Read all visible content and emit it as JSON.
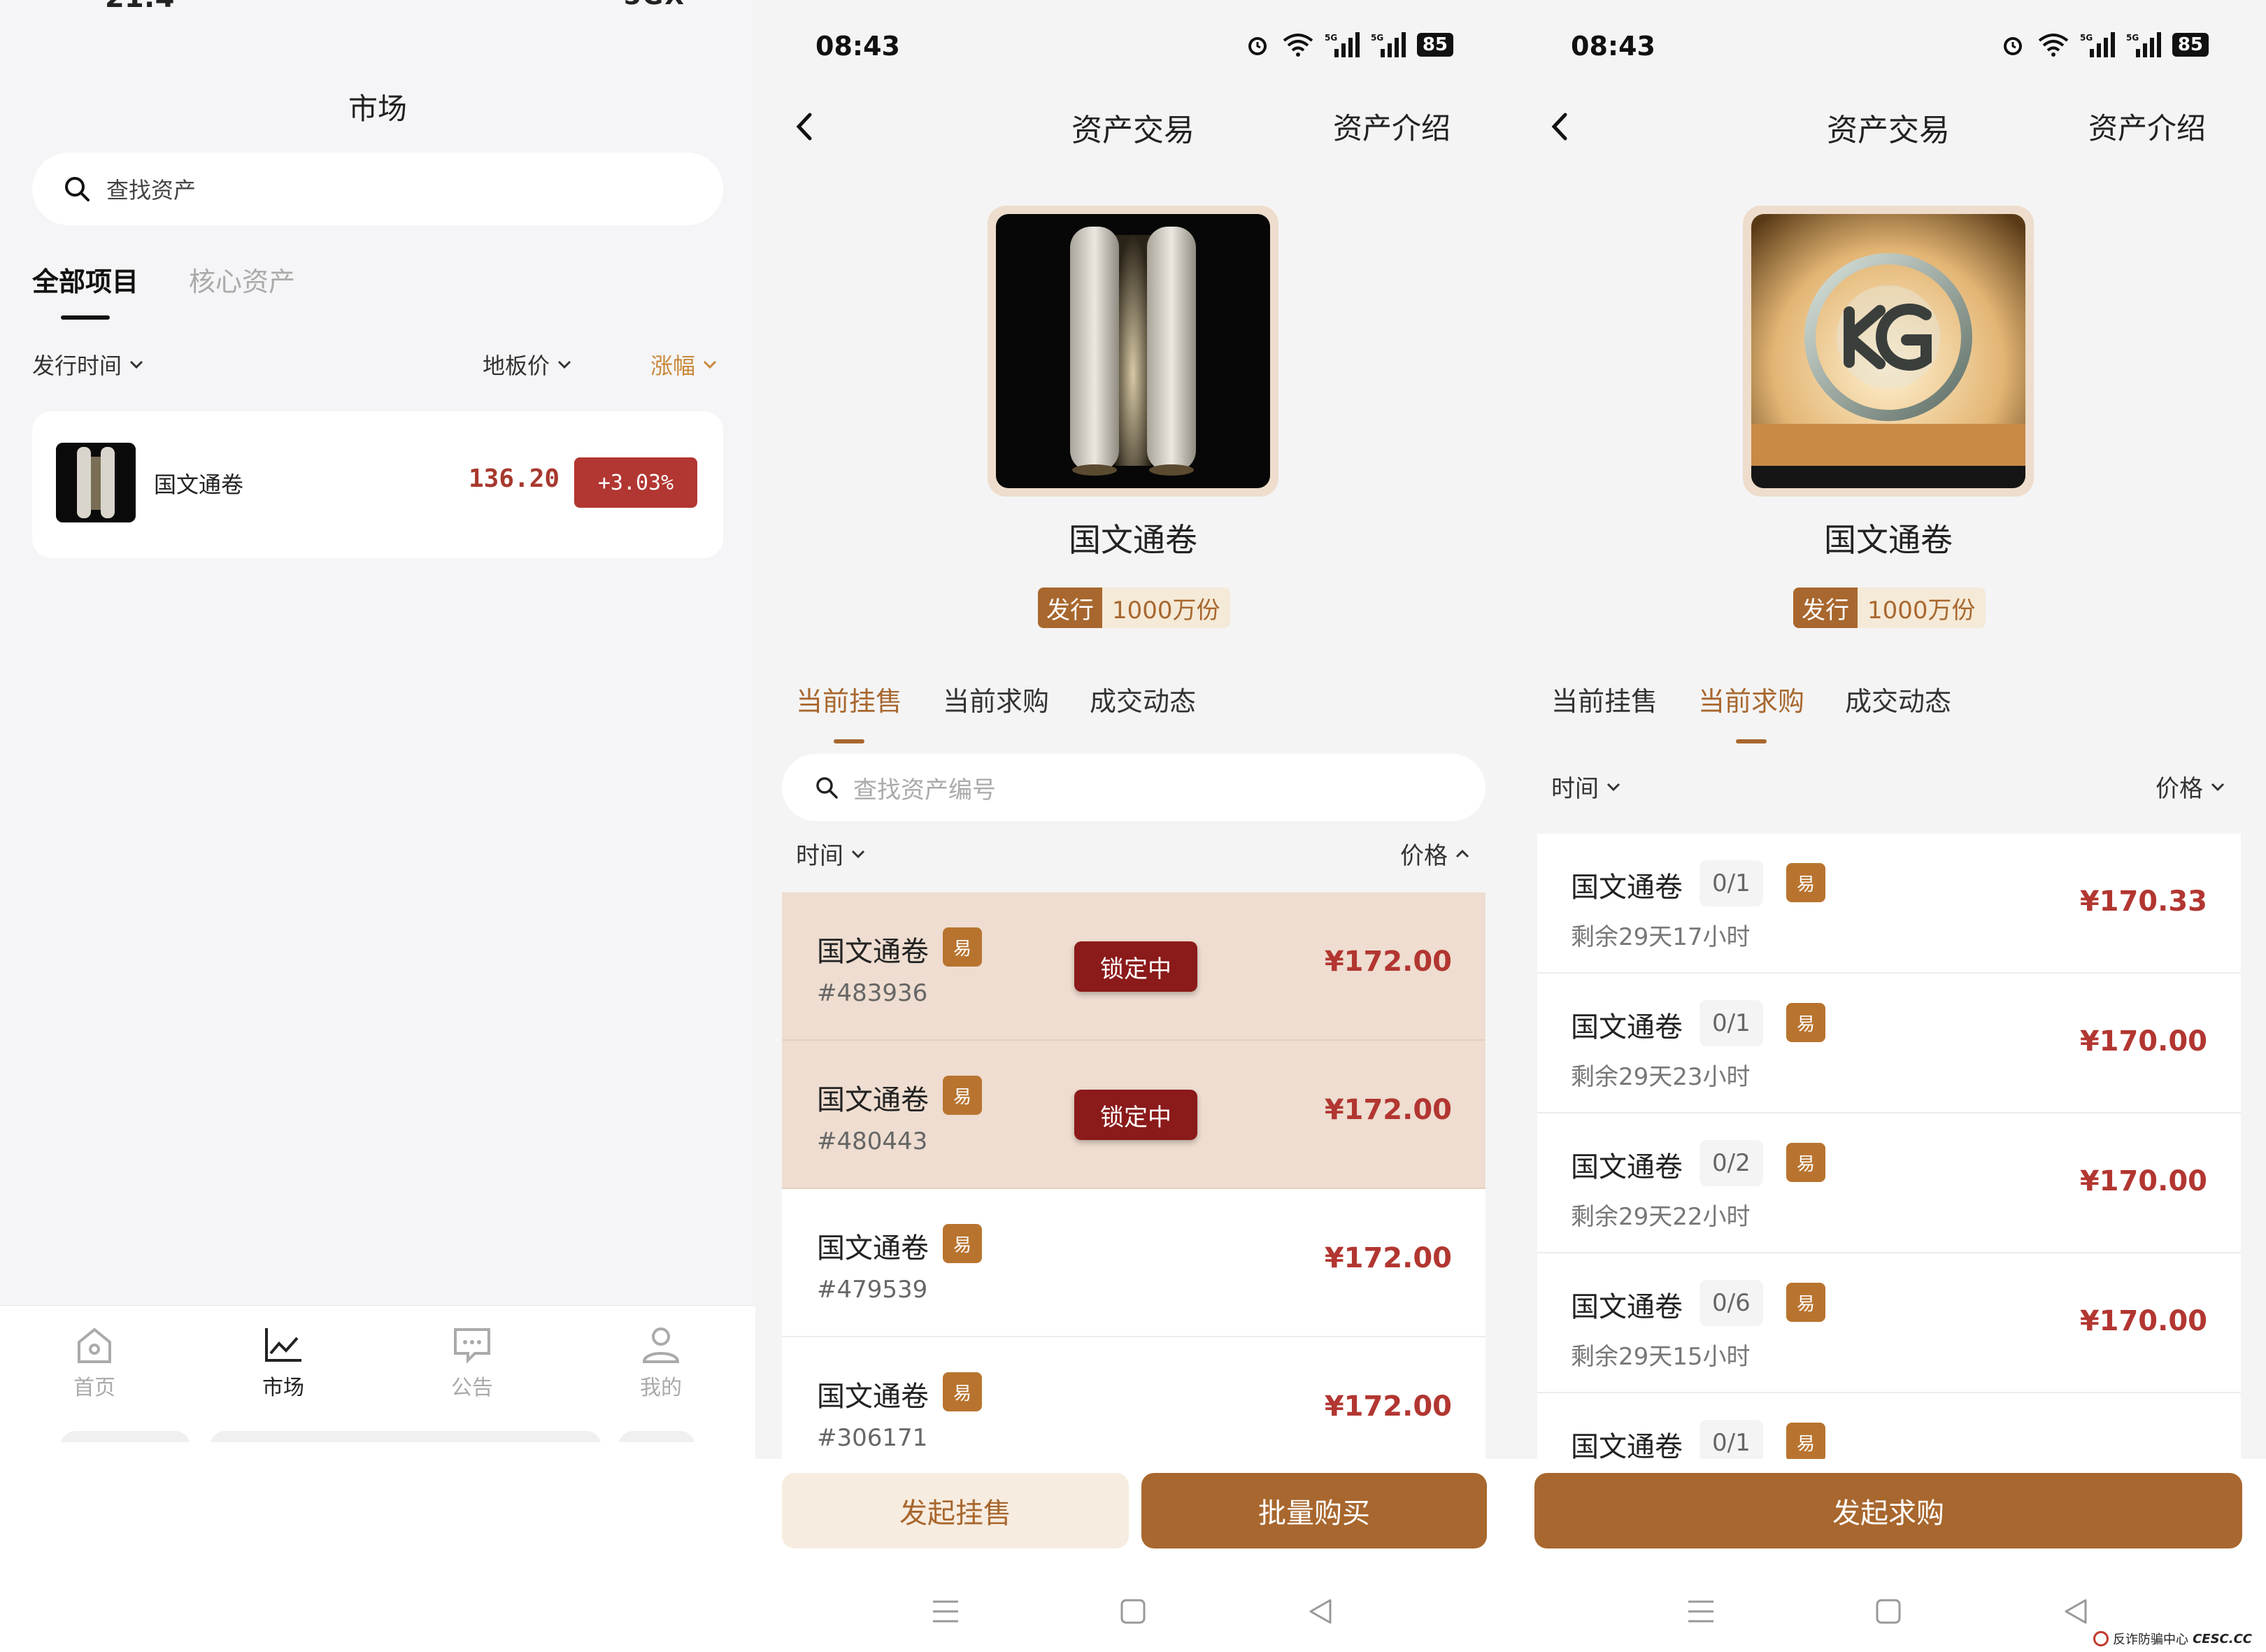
{
  "panel1": {
    "status_time": "21:4",
    "status_right": "5GX",
    "title": "市场",
    "search_placeholder": "查找资产",
    "tabs": [
      "全部项目",
      "核心资产"
    ],
    "filters": {
      "issue_time": "发行时间",
      "floor_price": "地板价",
      "change": "涨幅"
    },
    "card": {
      "name": "国文通卷",
      "price": "136.20",
      "change": "+3.03%"
    },
    "nav": [
      {
        "label": "首页",
        "icon": "home-icon"
      },
      {
        "label": "市场",
        "icon": "chart-icon"
      },
      {
        "label": "公告",
        "icon": "message-icon"
      },
      {
        "label": "我的",
        "icon": "user-icon"
      }
    ]
  },
  "status": {
    "time": "08:43",
    "battery": "85"
  },
  "header": {
    "title": "资产交易",
    "intro": "资产介绍"
  },
  "asset": {
    "name": "国文通卷",
    "issue_key": "发行",
    "issue_value": "1000万份"
  },
  "trade_tabs": [
    "当前挂售",
    "当前求购",
    "成交动态"
  ],
  "panel2": {
    "search_placeholder": "查找资产编号",
    "sort_time": "时间",
    "sort_price": "价格",
    "listings": [
      {
        "name": "国文通卷",
        "tag": "易",
        "id": "#483936",
        "status": "锁定中",
        "price": "¥172.00"
      },
      {
        "name": "国文通卷",
        "tag": "易",
        "id": "#480443",
        "status": "锁定中",
        "price": "¥172.00"
      },
      {
        "name": "国文通卷",
        "tag": "易",
        "id": "#479539",
        "status": "",
        "price": "¥172.00"
      },
      {
        "name": "国文通卷",
        "tag": "易",
        "id": "#306171",
        "status": "",
        "price": "¥172.00"
      }
    ],
    "btn_sell": "发起挂售",
    "btn_batch": "批量购买"
  },
  "panel3": {
    "sort_time": "时间",
    "sort_price": "价格",
    "bids": [
      {
        "name": "国文通卷",
        "qty": "0/1",
        "tag": "易",
        "remain": "剩余29天17小时",
        "price": "¥170.33"
      },
      {
        "name": "国文通卷",
        "qty": "0/1",
        "tag": "易",
        "remain": "剩余29天23小时",
        "price": "¥170.00"
      },
      {
        "name": "国文通卷",
        "qty": "0/2",
        "tag": "易",
        "remain": "剩余29天22小时",
        "price": "¥170.00"
      },
      {
        "name": "国文通卷",
        "qty": "0/6",
        "tag": "易",
        "remain": "剩余29天15小时",
        "price": "¥170.00"
      },
      {
        "name": "国文通卷",
        "qty": "0/1",
        "tag": "易",
        "remain": "",
        "price": ""
      }
    ],
    "btn_bid": "发起求购"
  },
  "watermark": {
    "text": "反诈防骗中心",
    "site": "CESC.CC"
  },
  "colors": {
    "accent": "#a8672e",
    "price_red": "#b23631",
    "lock_red": "#8b1a1a",
    "locked_row": "#eeddd0"
  }
}
